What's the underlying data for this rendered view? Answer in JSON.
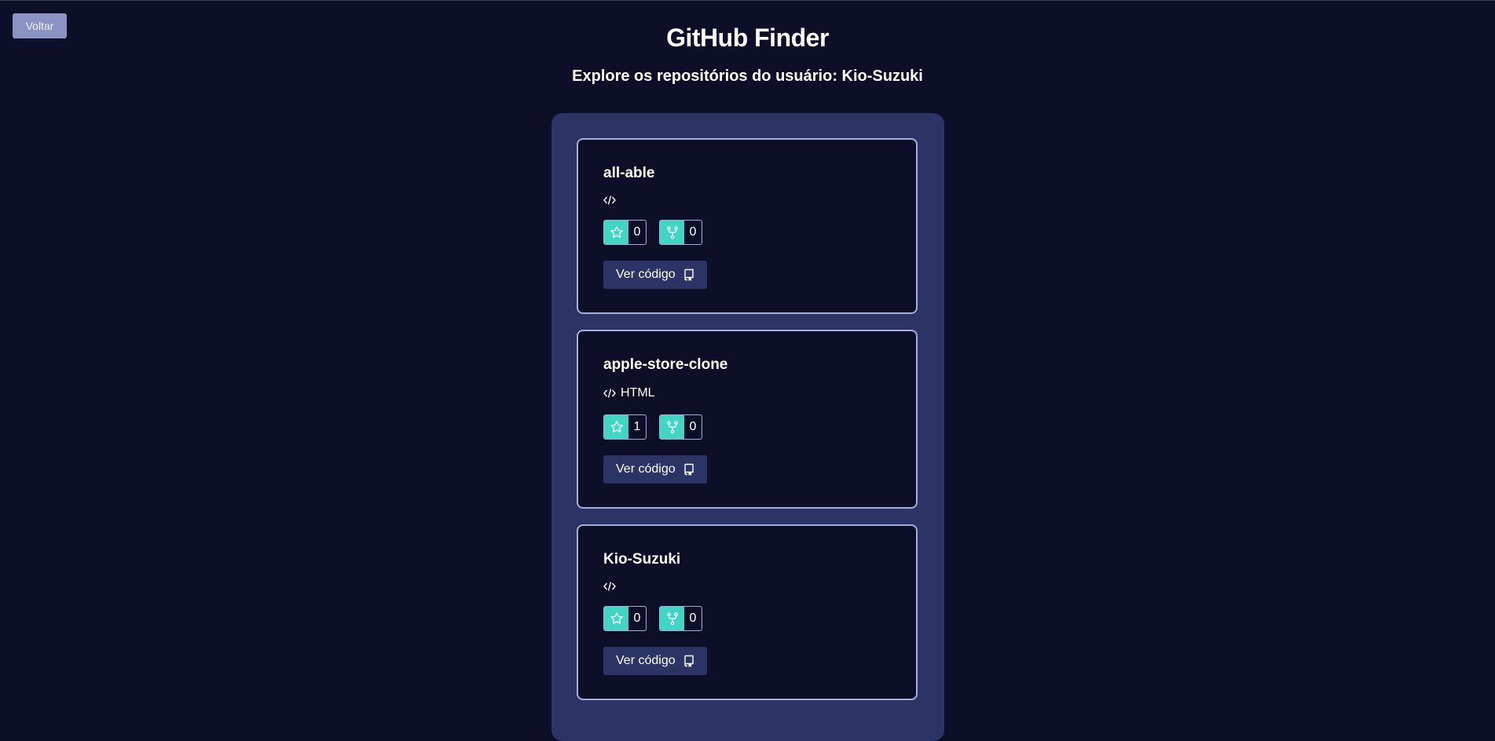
{
  "header": {
    "back_label": "Voltar",
    "title": "GitHub Finder",
    "subtitle": "Explore os repositórios do usuário: Kio-Suzuki"
  },
  "colors": {
    "background": "#0d0f28",
    "panel": "#2b3464",
    "accent": "#3fd6c4",
    "border": "#a6afd9",
    "back_button": "#8a93c4"
  },
  "repos": [
    {
      "name": "all-able",
      "language": "",
      "stars": "0",
      "forks": "0",
      "button_label": "Ver código"
    },
    {
      "name": "apple-store-clone",
      "language": "HTML",
      "stars": "1",
      "forks": "0",
      "button_label": "Ver código"
    },
    {
      "name": "Kio-Suzuki",
      "language": "",
      "stars": "0",
      "forks": "0",
      "button_label": "Ver código"
    }
  ],
  "icons": {
    "language": "code-icon",
    "stars": "star-icon",
    "forks": "fork-icon",
    "view_code": "repo-icon"
  }
}
